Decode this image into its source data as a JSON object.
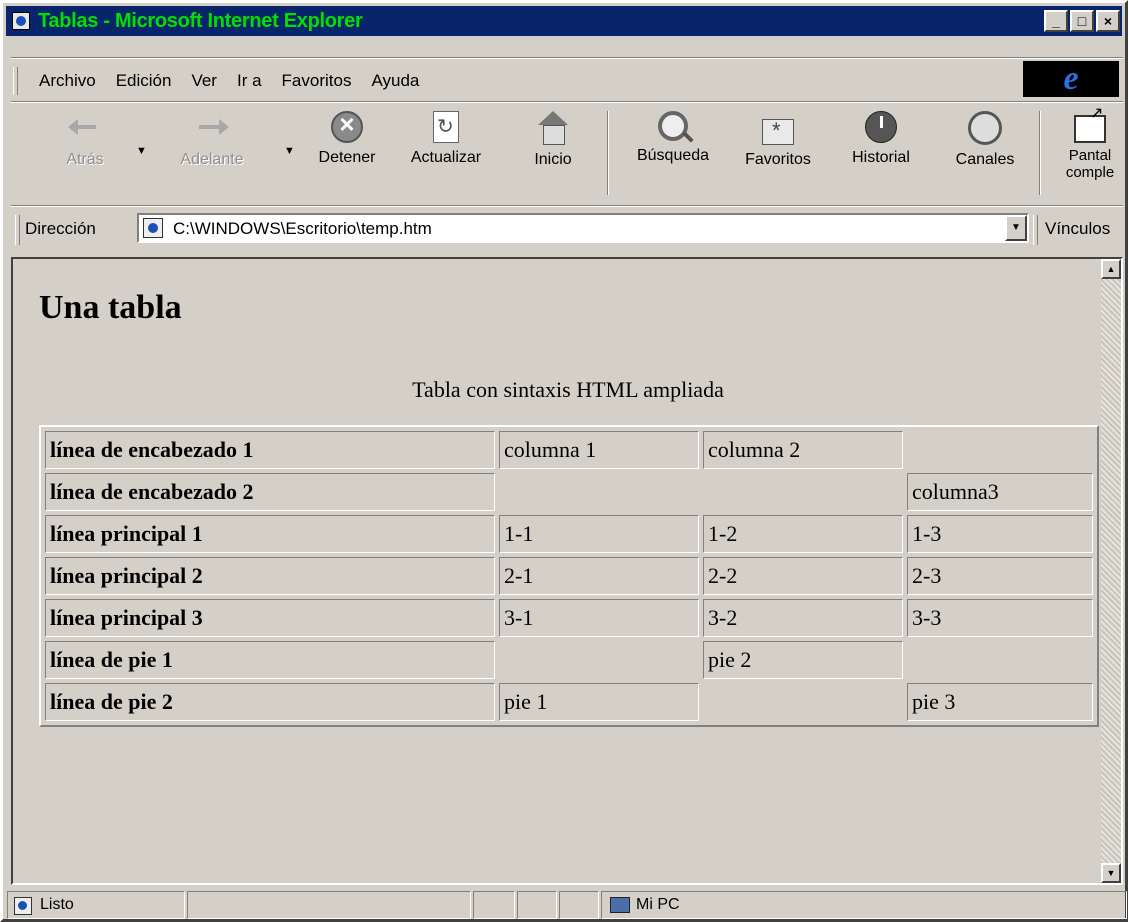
{
  "window": {
    "title": "Tablas - Microsoft Internet Explorer",
    "controls": [
      "_",
      "□",
      "×"
    ]
  },
  "menu": {
    "items": [
      "Archivo",
      "Edición",
      "Ver",
      "Ir a",
      "Favoritos",
      "Ayuda"
    ],
    "logo": "e"
  },
  "toolbar": {
    "back": "Atrás",
    "forward": "Adelante",
    "stop": "Detener",
    "refresh": "Actualizar",
    "home": "Inicio",
    "search": "Búsqueda",
    "favorites": "Favoritos",
    "history": "Historial",
    "channels": "Canales",
    "fullscreen_1": "Pantal",
    "fullscreen_2": "comple"
  },
  "address": {
    "label": "Dirección",
    "value": "C:\\WINDOWS\\Escritorio\\temp.htm",
    "links": "Vínculos"
  },
  "page": {
    "heading": "Una tabla",
    "caption": "Tabla con sintaxis HTML ampliada",
    "rows": [
      [
        "línea de encabezado 1",
        "columna 1",
        "columna 2",
        ""
      ],
      [
        "línea de encabezado 2",
        "",
        "",
        "columna3"
      ],
      [
        "línea principal 1",
        "1-1",
        "1-2",
        "1-3"
      ],
      [
        "línea principal 2",
        "2-1",
        "2-2",
        "2-3"
      ],
      [
        "línea principal 3",
        "3-1",
        "3-2",
        "3-3"
      ],
      [
        "línea de pie 1",
        "",
        "pie 2",
        ""
      ],
      [
        "línea de pie 2",
        "pie 1",
        "",
        "pie 3"
      ]
    ]
  },
  "status": {
    "text": "Listo",
    "zone": "Mi PC"
  }
}
